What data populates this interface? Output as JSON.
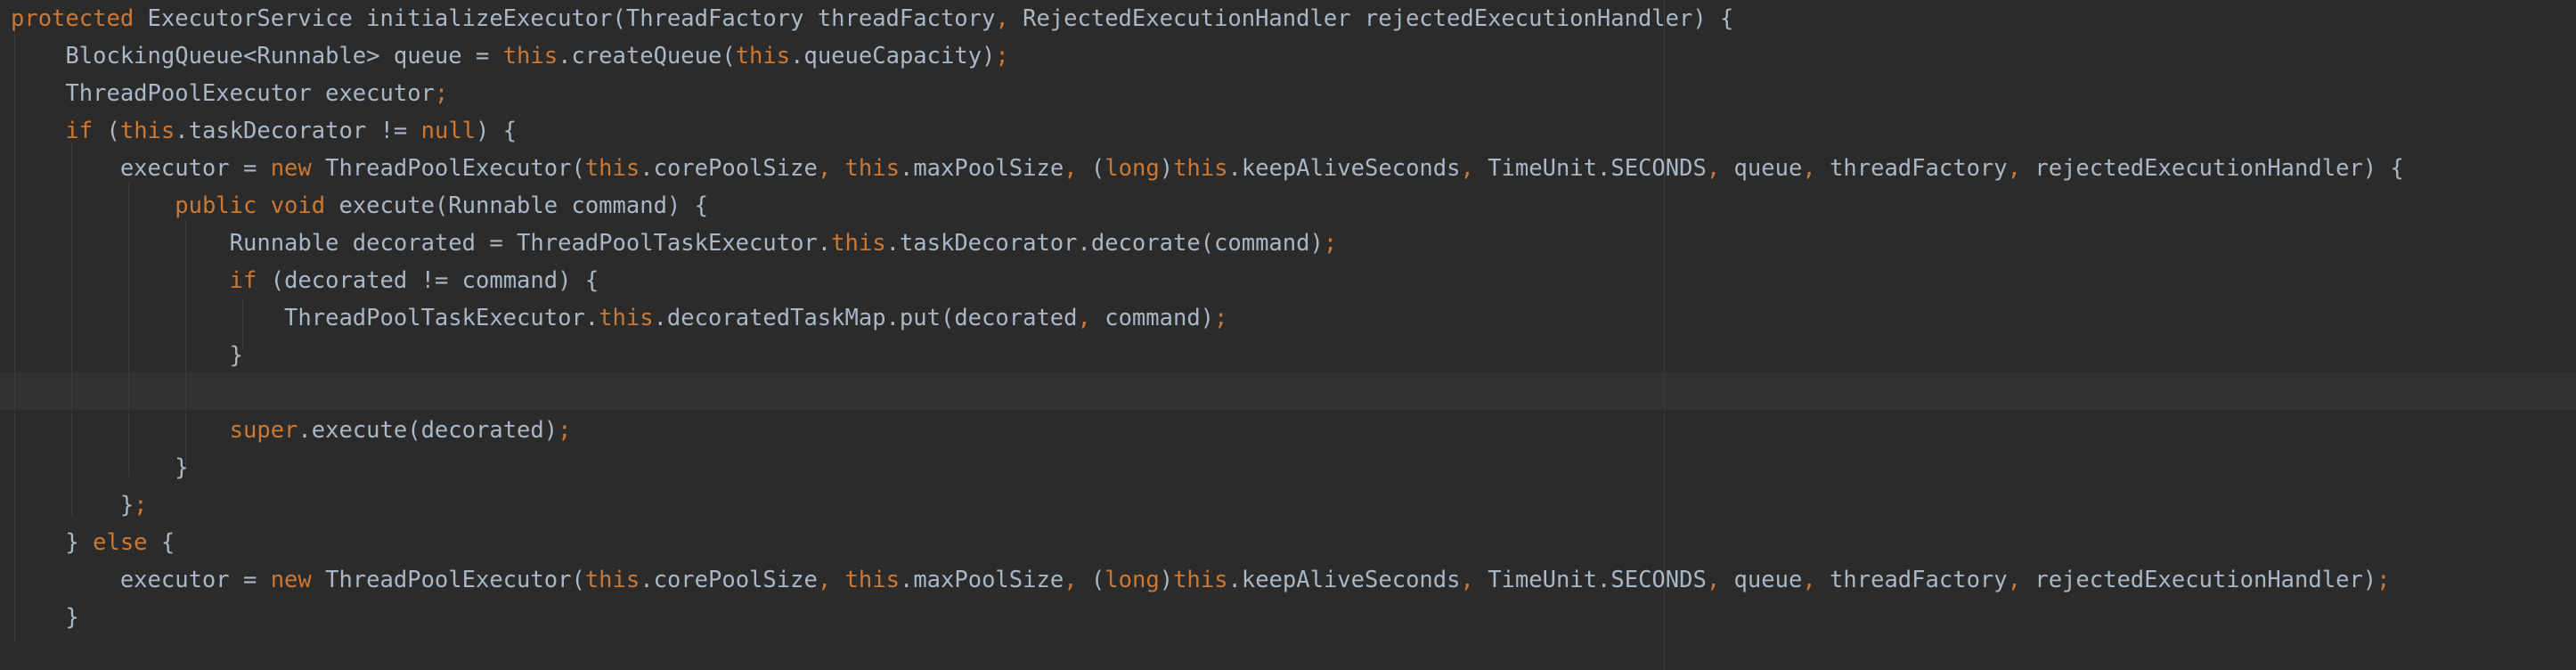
{
  "editor": {
    "colors": {
      "background": "#2b2b2b",
      "text": "#a9b7c6",
      "keyword": "#cc7832",
      "current_line": "#323232"
    },
    "lines": [
      {
        "segments": [
          {
            "t": "protected",
            "k": true
          },
          {
            "t": " ExecutorService initializeExecutor(ThreadFactory threadFactory",
            "k": false
          },
          {
            "t": ",",
            "k": true
          },
          {
            "t": " RejectedExecutionHandler rejectedExecutionHandler) {",
            "k": false
          }
        ]
      },
      {
        "segments": [
          {
            "t": "    BlockingQueue<Runnable> queue = ",
            "k": false
          },
          {
            "t": "this",
            "k": true
          },
          {
            "t": ".createQueue(",
            "k": false
          },
          {
            "t": "this",
            "k": true
          },
          {
            "t": ".queueCapacity)",
            "k": false
          },
          {
            "t": ";",
            "k": true
          }
        ]
      },
      {
        "segments": [
          {
            "t": "    ThreadPoolExecutor executor",
            "k": false
          },
          {
            "t": ";",
            "k": true
          }
        ]
      },
      {
        "segments": [
          {
            "t": "    ",
            "k": false
          },
          {
            "t": "if",
            "k": true
          },
          {
            "t": " (",
            "k": false
          },
          {
            "t": "this",
            "k": true
          },
          {
            "t": ".taskDecorator != ",
            "k": false
          },
          {
            "t": "null",
            "k": true
          },
          {
            "t": ") {",
            "k": false
          }
        ]
      },
      {
        "segments": [
          {
            "t": "        executor = ",
            "k": false
          },
          {
            "t": "new",
            "k": true
          },
          {
            "t": " ThreadPoolExecutor(",
            "k": false
          },
          {
            "t": "this",
            "k": true
          },
          {
            "t": ".corePoolSize",
            "k": false
          },
          {
            "t": ",",
            "k": true
          },
          {
            "t": " ",
            "k": false
          },
          {
            "t": "this",
            "k": true
          },
          {
            "t": ".maxPoolSize",
            "k": false
          },
          {
            "t": ",",
            "k": true
          },
          {
            "t": " (",
            "k": false
          },
          {
            "t": "long",
            "k": true
          },
          {
            "t": ")",
            "k": false
          },
          {
            "t": "this",
            "k": true
          },
          {
            "t": ".keepAliveSeconds",
            "k": false
          },
          {
            "t": ",",
            "k": true
          },
          {
            "t": " TimeUnit.SECONDS",
            "k": false
          },
          {
            "t": ",",
            "k": true
          },
          {
            "t": " queue",
            "k": false
          },
          {
            "t": ",",
            "k": true
          },
          {
            "t": " threadFactory",
            "k": false
          },
          {
            "t": ",",
            "k": true
          },
          {
            "t": " rejectedExecutionHandler) {",
            "k": false
          }
        ]
      },
      {
        "segments": [
          {
            "t": "            ",
            "k": false
          },
          {
            "t": "public void",
            "k": true
          },
          {
            "t": " execute(Runnable command) {",
            "k": false
          }
        ]
      },
      {
        "segments": [
          {
            "t": "                Runnable decorated = ThreadPoolTaskExecutor.",
            "k": false
          },
          {
            "t": "this",
            "k": true
          },
          {
            "t": ".taskDecorator.decorate(command)",
            "k": false
          },
          {
            "t": ";",
            "k": true
          }
        ]
      },
      {
        "segments": [
          {
            "t": "                ",
            "k": false
          },
          {
            "t": "if",
            "k": true
          },
          {
            "t": " (decorated != command) {",
            "k": false
          }
        ]
      },
      {
        "segments": [
          {
            "t": "                    ThreadPoolTaskExecutor.",
            "k": false
          },
          {
            "t": "this",
            "k": true
          },
          {
            "t": ".decoratedTaskMap.put(decorated",
            "k": false
          },
          {
            "t": ",",
            "k": true
          },
          {
            "t": " command)",
            "k": false
          },
          {
            "t": ";",
            "k": true
          }
        ]
      },
      {
        "segments": [
          {
            "t": "                }",
            "k": false
          }
        ]
      },
      {
        "segments": []
      },
      {
        "segments": [
          {
            "t": "                ",
            "k": false
          },
          {
            "t": "super",
            "k": true
          },
          {
            "t": ".execute(decorated)",
            "k": false
          },
          {
            "t": ";",
            "k": true
          }
        ]
      },
      {
        "segments": [
          {
            "t": "            }",
            "k": false
          }
        ]
      },
      {
        "segments": [
          {
            "t": "        }",
            "k": false
          },
          {
            "t": ";",
            "k": true
          }
        ]
      },
      {
        "segments": [
          {
            "t": "    } ",
            "k": false
          },
          {
            "t": "else",
            "k": true
          },
          {
            "t": " {",
            "k": false
          }
        ]
      },
      {
        "segments": [
          {
            "t": "        executor = ",
            "k": false
          },
          {
            "t": "new",
            "k": true
          },
          {
            "t": " ThreadPoolExecutor(",
            "k": false
          },
          {
            "t": "this",
            "k": true
          },
          {
            "t": ".corePoolSize",
            "k": false
          },
          {
            "t": ",",
            "k": true
          },
          {
            "t": " ",
            "k": false
          },
          {
            "t": "this",
            "k": true
          },
          {
            "t": ".maxPoolSize",
            "k": false
          },
          {
            "t": ",",
            "k": true
          },
          {
            "t": " (",
            "k": false
          },
          {
            "t": "long",
            "k": true
          },
          {
            "t": ")",
            "k": false
          },
          {
            "t": "this",
            "k": true
          },
          {
            "t": ".keepAliveSeconds",
            "k": false
          },
          {
            "t": ",",
            "k": true
          },
          {
            "t": " TimeUnit.SECONDS",
            "k": false
          },
          {
            "t": ",",
            "k": true
          },
          {
            "t": " queue",
            "k": false
          },
          {
            "t": ",",
            "k": true
          },
          {
            "t": " threadFactory",
            "k": false
          },
          {
            "t": ",",
            "k": true
          },
          {
            "t": " rejectedExecutionHandler)",
            "k": false
          },
          {
            "t": ";",
            "k": true
          }
        ]
      },
      {
        "segments": [
          {
            "t": "    }",
            "k": false
          }
        ]
      }
    ]
  }
}
